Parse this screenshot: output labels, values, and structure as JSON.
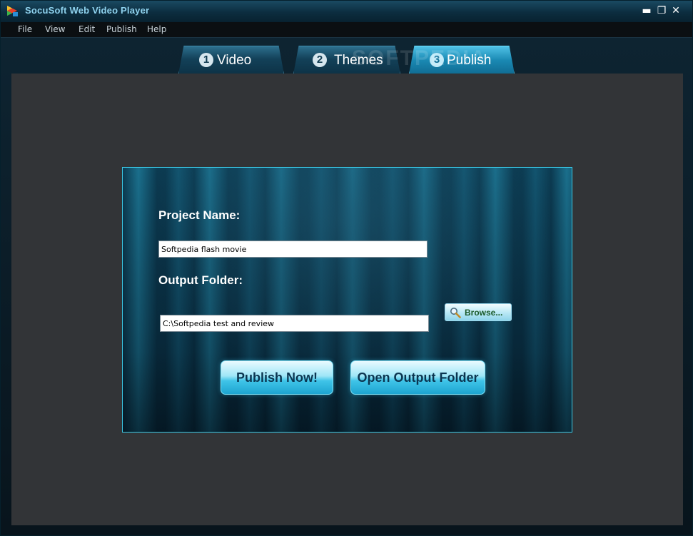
{
  "window": {
    "title": "SocuSoft Web Video Player",
    "minimize_glyph": "▬",
    "maximize_glyph": "❐",
    "close_glyph": "✕"
  },
  "menu": {
    "items": [
      "File",
      "View",
      "Edit",
      "Publish",
      "Help"
    ]
  },
  "tabs": [
    {
      "number": "1",
      "label": "Video",
      "active": false
    },
    {
      "number": "2",
      "label": "Themes",
      "active": false
    },
    {
      "number": "3",
      "label": "Publish",
      "active": true
    }
  ],
  "watermark": "SOFTPEDIA",
  "publish": {
    "project_name_label": "Project Name:",
    "project_name_value": "Softpedia flash movie",
    "output_folder_label": "Output Folder:",
    "output_folder_value": "C:\\Softpedia test and review",
    "browse_label": "Browse...",
    "publish_now_label": "Publish Now!",
    "open_output_folder_label": "Open Output Folder"
  },
  "colors": {
    "accent": "#3bc9e6",
    "title_text": "#8fd2ee",
    "content_bg": "#323437"
  },
  "icons": {
    "app": "app-logo-icon",
    "browse": "magnifier-icon"
  }
}
